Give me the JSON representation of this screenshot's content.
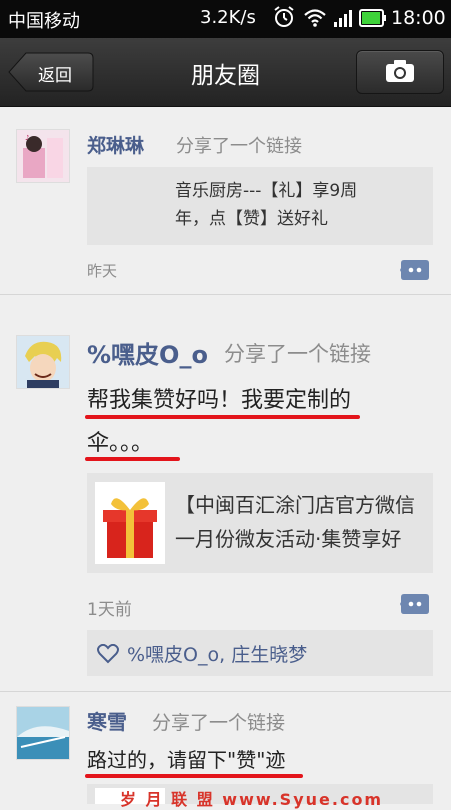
{
  "status_bar": {
    "carrier": "中国移动",
    "speed": "3.2K/s",
    "time": "18:00"
  },
  "nav": {
    "back_label": "返回",
    "title": "朋友圈"
  },
  "posts": [
    {
      "author": "郑琳琳",
      "action": "分享了一个链接",
      "link_text_1": "音乐厨房---【礼】享9周",
      "link_text_2": "年，点【赞】送好礼",
      "time": "昨天"
    },
    {
      "author": "%嘿皮O_o",
      "action": "分享了一个链接",
      "text_1": "帮我集赞好吗！我要定制的",
      "text_2": "伞。。。",
      "link_text_1": "【中闽百汇涂门店官方微信",
      "link_text_2": "一月份微友活动·集赞享好",
      "time": "1天前",
      "likes": "%嘿皮O_o, 庄生晓梦"
    },
    {
      "author": "寒雪",
      "action": "分享了一个链接",
      "text_1": "路过的，请留下\"赞\"迹"
    }
  ],
  "watermark": "岁 月 联 盟  www.Syue.com",
  "colors": {
    "author": "#4a5e8c",
    "highlight_underline": "#e3141b",
    "navbar": "#2f2f2f"
  }
}
